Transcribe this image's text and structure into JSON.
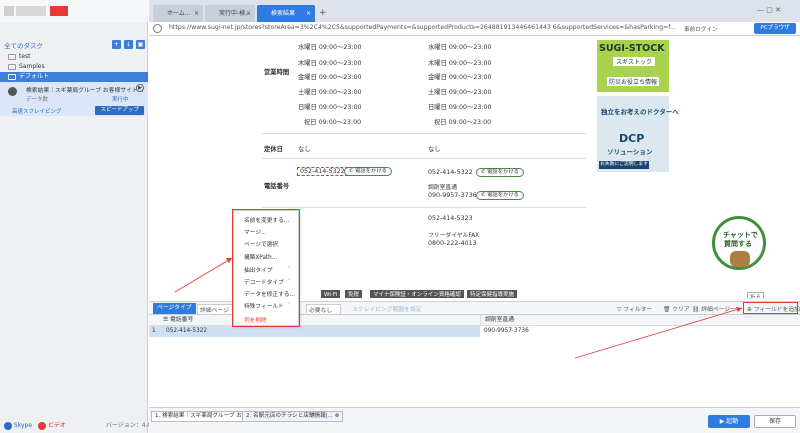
{
  "app": {
    "version": "バージョン：4.0.2"
  },
  "sidebar": {
    "header": "全てのタスク",
    "tree": [
      {
        "label": "test"
      },
      {
        "label": "Samples"
      },
      {
        "label": "デフォルト"
      }
    ],
    "task": {
      "title": "検索結果｜スギ薬局グループ お客様サイト...",
      "sub1": "データ数",
      "status": "実行中",
      "mode": "高速スクレイピング",
      "speed_btn": "スピードアップ"
    },
    "footer": {
      "skype": "Skype",
      "video": "ビデオ"
    }
  },
  "browser": {
    "tabs": [
      {
        "label": "ホーム..."
      },
      {
        "label": "実行中-検..."
      },
      {
        "label": "検索結果"
      }
    ],
    "add_tab": "+",
    "url": "https://www.sugi-net.jp/stores?storeArea=3%2C4%2C5&supportedPayments=&supportedProducts=264881913446461443 6&supportedServices=&hasParking=f...",
    "login": "事前ログイン",
    "pc_btn": "PCブラウザ"
  },
  "web": {
    "hours_label": "営業時間",
    "col1_hours": [
      "水曜日 09:00〜23:00",
      "木曜日 09:00〜23:00",
      "金曜日 09:00〜23:00",
      "土曜日 09:00〜23:00",
      "日曜日 09:00〜23:00",
      "祝日 09:00〜23:00"
    ],
    "col2_hours": [
      "水曜日 09:00〜23:00",
      "木曜日 09:00〜23:00",
      "金曜日 09:00〜23:00",
      "土曜日 09:00〜23:00",
      "日曜日 09:00〜23:00",
      "祝日 09:00〜23:00"
    ],
    "holiday_label": "定休日",
    "holiday_col1": "なし",
    "holiday_col2": "なし",
    "phone_label": "電話番号",
    "phone_col1": "052-414-5322",
    "call_label": "電話をかける",
    "phone_col2": "052-414-5322",
    "dispense_label": "調剤室直通",
    "dispense_phone": "090-9957-3736",
    "fax_col2": "052-414-5323",
    "free_fax_label": "フリーダイヤルFAX",
    "free_fax": "0800-222-4013",
    "banner_links": [
      "Wi-Fi",
      "免税",
      "マイナ保険証・オンライン資格確認",
      "特定保健指導実施"
    ],
    "ad1": {
      "title": "SUGI-STOCK",
      "sub": "スギストック",
      "tag": "防災お役立ち情報"
    },
    "ad2": {
      "text": "独立をお考えのドクターへ",
      "brand": "DCP",
      "sub": "ソリューション",
      "foot": "お失敗にご説明します"
    },
    "chat": {
      "line1": "チャットで",
      "line2": "質問する"
    },
    "fold": "折る"
  },
  "context_menu": {
    "items": [
      "名前を変更する...",
      "マージ...",
      "ページで選択",
      "構築XPath...",
      "抽出タイプ",
      "デコードタイプ",
      "データを修正する...",
      "特殊フィールド",
      "列を削除"
    ]
  },
  "toolbar": {
    "page_type": "ページタイプ",
    "detail_page": "詳細ページ",
    "not_needed": "必要なし",
    "scrape_range": "スクレイピング範囲を設定",
    "filter": "フィルター",
    "clear": "クリア",
    "detail_page_tab": "詳細ページ一",
    "add_field": "フィールドを追加"
  },
  "grid": {
    "columns": [
      "電話番号",
      "調剤室直通"
    ],
    "rows": [
      {
        "index": "1",
        "phone": "052-414-5322",
        "dispense": "090-9957-3736"
      }
    ]
  },
  "status": {
    "tabs": [
      "1. 検索結果｜スギ薬局グループ お...",
      "2. 名駅元店のチラシと店舗情報|..."
    ],
    "start": "▶ 起動",
    "save": "保存"
  }
}
